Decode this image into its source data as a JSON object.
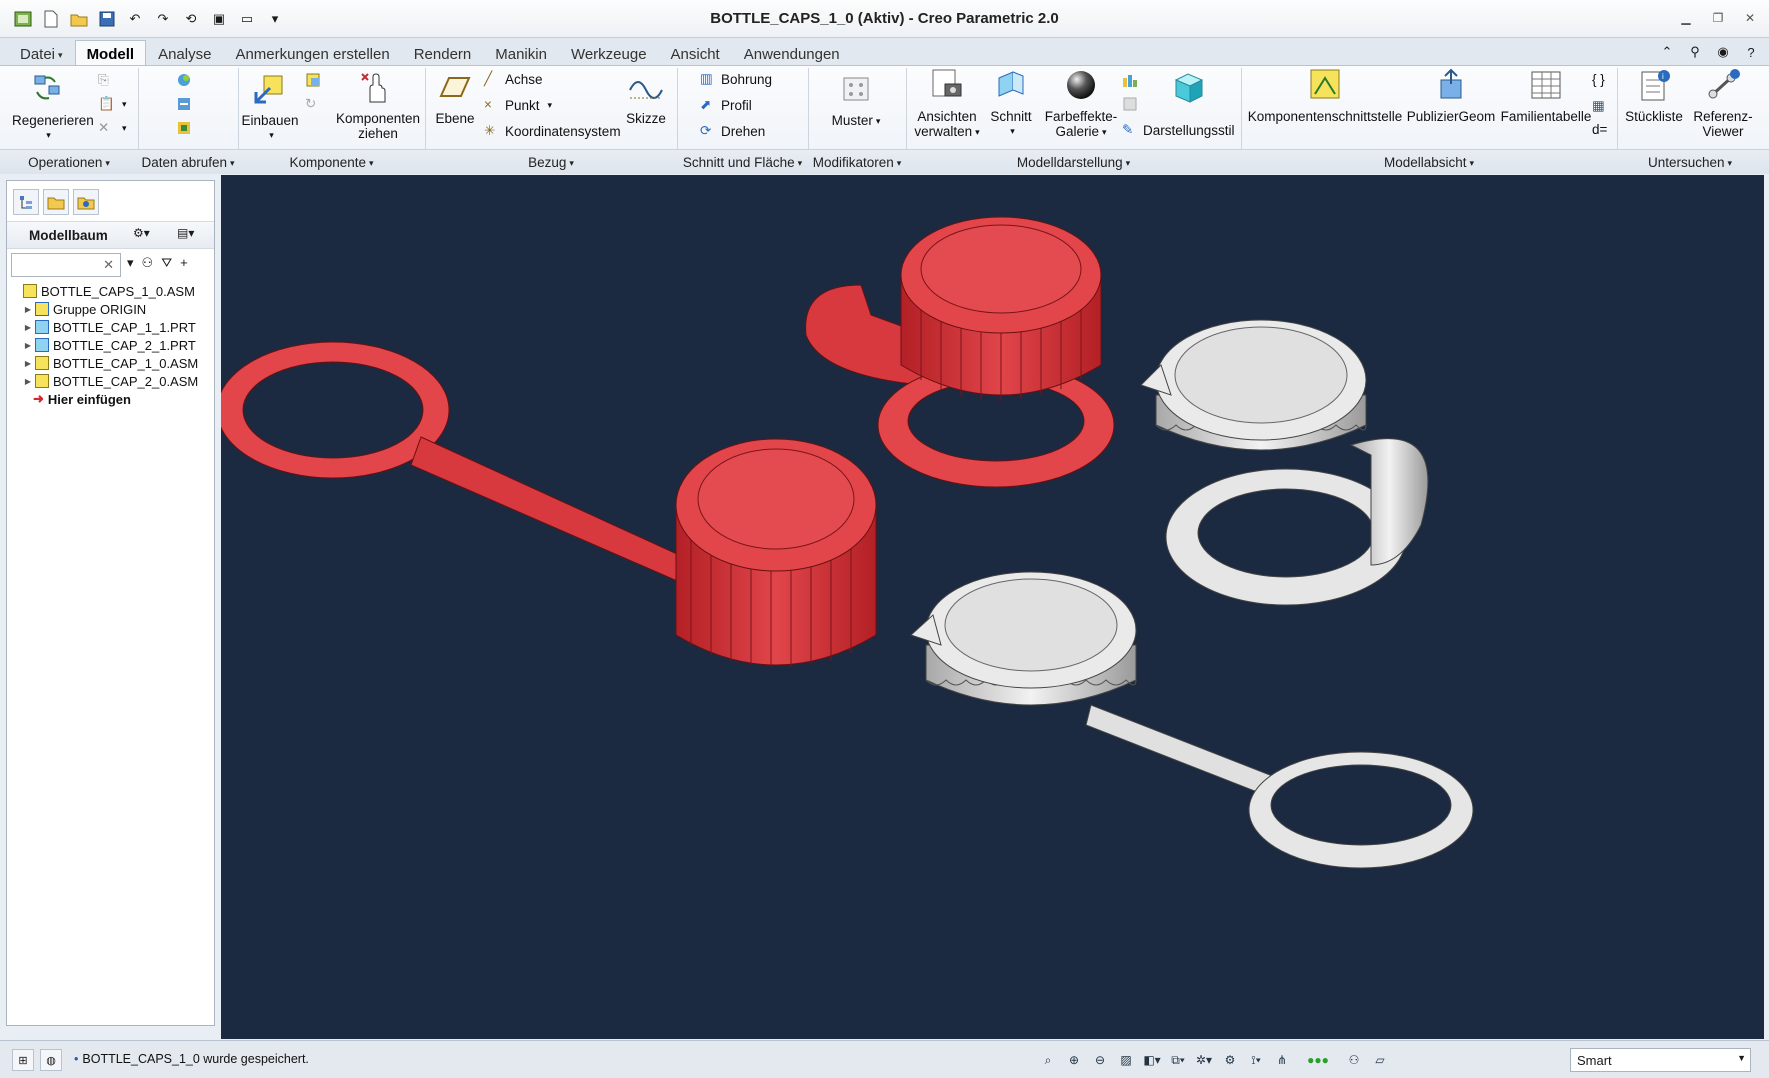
{
  "window": {
    "title": "BOTTLE_CAPS_1_0 (Aktiv) - Creo Parametric 2.0",
    "controls": [
      "minimize-icon",
      "restore-icon",
      "close-icon"
    ]
  },
  "tabs": [
    {
      "label": "Datei",
      "caret": "▾"
    },
    {
      "label": "Modell"
    },
    {
      "label": "Analyse"
    },
    {
      "label": "Anmerkungen erstellen"
    },
    {
      "label": "Rendern"
    },
    {
      "label": "Manikin"
    },
    {
      "label": "Werkzeuge"
    },
    {
      "label": "Ansicht"
    },
    {
      "label": "Anwendungen"
    }
  ],
  "ribbon": {
    "regenerieren": "Regenerieren",
    "einbauen": "Einbauen",
    "komponenten": "Komponenten",
    "ziehen": "ziehen",
    "ebene": "Ebene",
    "achse": "Achse",
    "punkt": "Punkt",
    "koordinatensystem": "Koordinatensystem",
    "skizze": "Skizze",
    "bohrung": "Bohrung",
    "profil": "Profil",
    "drehen": "Drehen",
    "muster": "Muster",
    "ansichten": "Ansichten",
    "verwalten": "verwalten",
    "schnitt": "Schnitt",
    "farbeffekte": "Farbeffekte-",
    "galerie": "Galerie",
    "darstellungsstil": "Darstellungsstil",
    "komponentenschnittstelle": "Komponentenschnittstelle",
    "publiziergeom": "PublizierGeom",
    "familientabelle": "Familientabelle",
    "stueckliste": "Stückliste",
    "referenz": "Referenz-",
    "viewer": "Viewer",
    "d_eq": "d="
  },
  "groups": {
    "operationen": "Operationen",
    "daten_abrufen": "Daten abrufen",
    "komponente": "Komponente",
    "bezug": "Bezug",
    "schnitt_flaeche": "Schnitt und Fläche",
    "modifikatoren": "Modifikatoren",
    "modelldarstellung": "Modelldarstellung",
    "modellabsicht": "Modellabsicht",
    "untersuchen": "Untersuchen"
  },
  "modeltree": {
    "title": "Modellbaum",
    "search_value": "",
    "items": [
      {
        "label": "BOTTLE_CAPS_1_0.ASM",
        "icon": "assembly-icon",
        "expander": ""
      },
      {
        "label": "Gruppe ORIGIN",
        "icon": "group-icon",
        "expander": "▶"
      },
      {
        "label": "BOTTLE_CAP_1_1.PRT",
        "icon": "part-icon",
        "expander": "▶"
      },
      {
        "label": "BOTTLE_CAP_2_1.PRT",
        "icon": "part-icon",
        "expander": "▶"
      },
      {
        "label": "BOTTLE_CAP_1_0.ASM",
        "icon": "assembly-icon",
        "expander": "▶"
      },
      {
        "label": "BOTTLE_CAP_2_0.ASM",
        "icon": "assembly-icon",
        "expander": "▶"
      },
      {
        "label": "Hier einfügen",
        "icon": "insert-arrow-icon",
        "expander": ""
      }
    ]
  },
  "status": {
    "message": "BOTTLE_CAPS_1_0 wurde gespeichert.",
    "filter_value": "Smart"
  },
  "colors": {
    "viewport_bg": "#1b2a41",
    "red_part": "#e2464a",
    "white_part": "#e6e6e6",
    "accent_blue": "#1f5fbf"
  }
}
